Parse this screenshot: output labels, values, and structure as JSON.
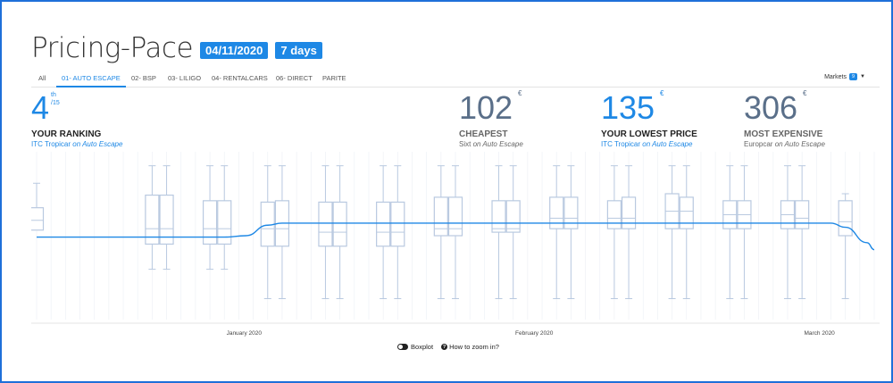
{
  "header": {
    "title": "Pricing-Pace",
    "date_badge": "04/11/2020",
    "days_badge": "7 days"
  },
  "tabs": [
    {
      "label": "All",
      "active": false
    },
    {
      "label": "01- AUTO ESCAPE",
      "active": true
    },
    {
      "label": "02- BSP",
      "active": false
    },
    {
      "label": "03- LILIGO",
      "active": false
    },
    {
      "label": "04- RENTALCARS",
      "active": false
    },
    {
      "label": "06- DIRECT",
      "active": false
    },
    {
      "label": "PARITE",
      "active": false
    }
  ],
  "markets": {
    "label": "Markets",
    "badge": "9"
  },
  "ranking": {
    "value": "4",
    "suffix": "th",
    "total": "/15",
    "label": "YOUR RANKING",
    "company": "ITC Tropicar",
    "channel": "on Auto Escape"
  },
  "cheapest": {
    "value": "102",
    "currency": "€",
    "label": "CHEAPEST",
    "company": "Sixt",
    "channel": "on Auto Escape"
  },
  "lowest": {
    "value": "135",
    "currency": "€",
    "label": "YOUR LOWEST PRICE",
    "company": "ITC Tropicar",
    "channel": "on Auto Escape"
  },
  "expensive": {
    "value": "306",
    "currency": "€",
    "label": "MOST EXPENSIVE",
    "company": "Europcar",
    "channel": "on Auto Escape"
  },
  "footer": {
    "boxplot_label": "Boxplot",
    "zoom_label": "How to zoom in?"
  },
  "colors": {
    "accent": "#1e88e5",
    "box": "#b9c9e0",
    "line": "#1e88e5"
  },
  "chart_data": {
    "type": "boxplot-line",
    "x_ticks": [
      "January 2020",
      "February 2020",
      "March 2020"
    ],
    "boxes": [
      {
        "min": 170,
        "q1": 148,
        "median": 162,
        "q3": 180,
        "max": 215,
        "x": 0
      },
      {
        "min": 92,
        "q1": 128,
        "median": 150,
        "q3": 198,
        "max": 240,
        "x": 8
      },
      {
        "min": 92,
        "q1": 128,
        "median": 150,
        "q3": 198,
        "max": 240,
        "x": 9
      },
      {
        "min": 92,
        "q1": 128,
        "median": 150,
        "q3": 190,
        "max": 240,
        "x": 12
      },
      {
        "min": 92,
        "q1": 128,
        "median": 150,
        "q3": 190,
        "max": 240,
        "x": 13
      },
      {
        "min": 50,
        "q1": 125,
        "median": 150,
        "q3": 188,
        "max": 240,
        "x": 16
      },
      {
        "min": 50,
        "q1": 125,
        "median": 150,
        "q3": 190,
        "max": 240,
        "x": 17
      },
      {
        "min": 50,
        "q1": 125,
        "median": 145,
        "q3": 188,
        "max": 240,
        "x": 20
      },
      {
        "min": 50,
        "q1": 125,
        "median": 145,
        "q3": 188,
        "max": 240,
        "x": 21
      },
      {
        "min": 50,
        "q1": 125,
        "median": 145,
        "q3": 188,
        "max": 240,
        "x": 24
      },
      {
        "min": 50,
        "q1": 125,
        "median": 145,
        "q3": 188,
        "max": 240,
        "x": 25
      },
      {
        "min": 50,
        "q1": 140,
        "median": 150,
        "q3": 195,
        "max": 240,
        "x": 28
      },
      {
        "min": 50,
        "q1": 140,
        "median": 150,
        "q3": 195,
        "max": 240,
        "x": 29
      },
      {
        "min": 50,
        "q1": 145,
        "median": 150,
        "q3": 190,
        "max": 240,
        "x": 32
      },
      {
        "min": 50,
        "q1": 145,
        "median": 150,
        "q3": 190,
        "max": 240,
        "x": 33
      },
      {
        "min": 50,
        "q1": 150,
        "median": 165,
        "q3": 195,
        "max": 240,
        "x": 36
      },
      {
        "min": 50,
        "q1": 150,
        "median": 165,
        "q3": 195,
        "max": 240,
        "x": 37
      },
      {
        "min": 50,
        "q1": 150,
        "median": 165,
        "q3": 190,
        "max": 240,
        "x": 40
      },
      {
        "min": 50,
        "q1": 150,
        "median": 165,
        "q3": 195,
        "max": 240,
        "x": 41
      },
      {
        "min": 50,
        "q1": 150,
        "median": 175,
        "q3": 200,
        "max": 240,
        "x": 44
      },
      {
        "min": 50,
        "q1": 150,
        "median": 175,
        "q3": 195,
        "max": 240,
        "x": 45
      },
      {
        "min": 50,
        "q1": 150,
        "median": 170,
        "q3": 190,
        "max": 240,
        "x": 48
      },
      {
        "min": 50,
        "q1": 150,
        "median": 170,
        "q3": 190,
        "max": 240,
        "x": 49
      },
      {
        "min": 50,
        "q1": 150,
        "median": 170,
        "q3": 190,
        "max": 240,
        "x": 52
      },
      {
        "min": 50,
        "q1": 150,
        "median": 165,
        "q3": 190,
        "max": 240,
        "x": 53
      },
      {
        "min": 50,
        "q1": 140,
        "median": 160,
        "q3": 190,
        "max": 200,
        "x": 56
      }
    ],
    "line": [
      {
        "x": 0,
        "y": 138
      },
      {
        "x": 13,
        "y": 138
      },
      {
        "x": 14.5,
        "y": 140
      },
      {
        "x": 16,
        "y": 155
      },
      {
        "x": 17,
        "y": 158
      },
      {
        "x": 55,
        "y": 158
      },
      {
        "x": 56,
        "y": 152
      },
      {
        "x": 57.5,
        "y": 130
      },
      {
        "x": 58,
        "y": 120
      }
    ],
    "x_range": [
      0,
      58
    ],
    "ylim": [
      20,
      260
    ]
  }
}
